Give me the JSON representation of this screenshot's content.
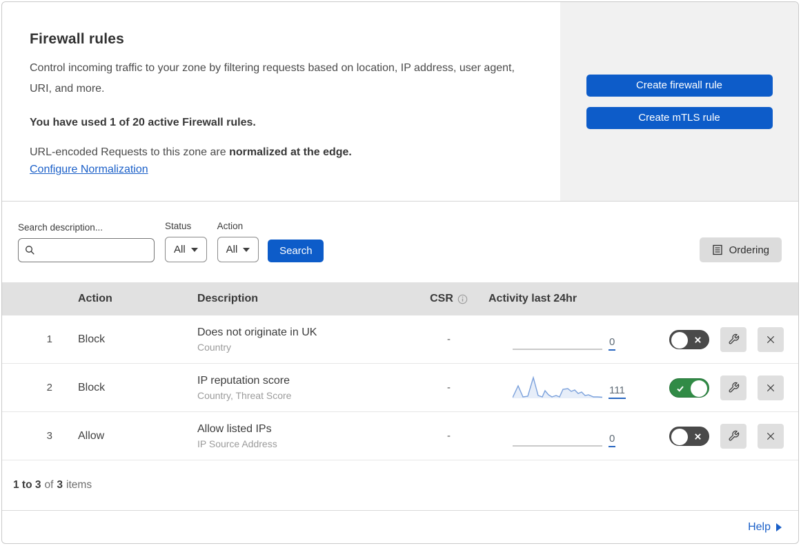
{
  "panel": {
    "title": "Firewall rules",
    "description": "Control incoming traffic to your zone by filtering requests based on location, IP address, user agent, URI, and more.",
    "usage_text": "You have used 1 of 20 active Firewall rules.",
    "normalization_regular": "URL-encoded Requests to this zone are ",
    "normalization_bold": "normalized at the edge.",
    "configure_link": "Configure Normalization",
    "create_firewall_label": "Create firewall rule",
    "create_mtls_label": "Create mTLS rule"
  },
  "filters": {
    "search_label": "Search description...",
    "search_value": "",
    "status_label": "Status",
    "status_value": "All",
    "action_label": "Action",
    "action_value": "All",
    "search_button": "Search",
    "ordering_button": "Ordering"
  },
  "table": {
    "columns": {
      "action": "Action",
      "description": "Description",
      "csr": "CSR",
      "activity": "Activity last 24hr"
    },
    "rows": [
      {
        "index": "1",
        "action": "Block",
        "description": "Does not originate in UK",
        "fields": "Country",
        "csr": "-",
        "activity_count": "0",
        "enabled": false,
        "sparkline": null
      },
      {
        "index": "2",
        "action": "Block",
        "description": "IP reputation score",
        "fields": "Country, Threat Score",
        "csr": "-",
        "activity_count": "111",
        "enabled": true,
        "sparkline": [
          [
            0,
            32
          ],
          [
            8,
            15
          ],
          [
            15,
            31
          ],
          [
            22,
            30
          ],
          [
            30,
            3
          ],
          [
            37,
            29
          ],
          [
            43,
            31
          ],
          [
            47,
            22
          ],
          [
            52,
            28
          ],
          [
            57,
            31
          ],
          [
            63,
            29
          ],
          [
            68,
            31
          ],
          [
            73,
            20
          ],
          [
            80,
            19
          ],
          [
            85,
            23
          ],
          [
            90,
            21
          ],
          [
            95,
            26
          ],
          [
            100,
            24
          ],
          [
            105,
            29
          ],
          [
            110,
            28
          ],
          [
            117,
            31
          ],
          [
            123,
            31
          ],
          [
            130,
            31.5
          ]
        ]
      },
      {
        "index": "3",
        "action": "Allow",
        "description": "Allow listed IPs",
        "fields": "IP Source Address",
        "csr": "-",
        "activity_count": "0",
        "enabled": false,
        "sparkline": null
      }
    ]
  },
  "footer": {
    "range": "1 to 3",
    "of_text": "of",
    "total": "3",
    "items_text": "items",
    "help_label": "Help"
  },
  "colors": {
    "accent_blue": "#0d5cc9",
    "link_blue": "#1a5fc8",
    "toggle_on_green": "#318b46",
    "toggle_off_gray": "#4a4a4a",
    "sparkline_blue": "#7aa0db",
    "panel_gray": "#f1f1f1",
    "table_header_gray": "#e1e1e1"
  }
}
